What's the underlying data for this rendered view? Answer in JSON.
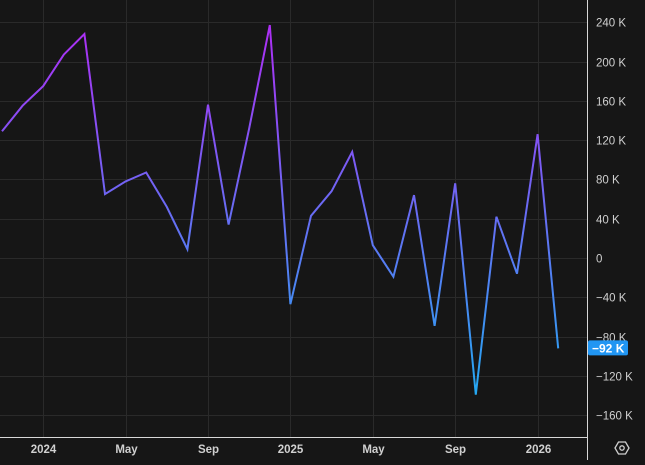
{
  "chart_data": {
    "type": "line",
    "title": "",
    "xlabel": "",
    "ylabel": "",
    "x": [
      "2023-11",
      "2023-12",
      "2024-01",
      "2024-02",
      "2024-03",
      "2024-04",
      "2024-05",
      "2024-06",
      "2024-07",
      "2024-08",
      "2024-09",
      "2024-10",
      "2024-11",
      "2024-12",
      "2025-01",
      "2025-02",
      "2025-03",
      "2025-04",
      "2025-05",
      "2025-06",
      "2025-07",
      "2025-08",
      "2025-09",
      "2025-10",
      "2025-11",
      "2025-12",
      "2026-01",
      "2026-02"
    ],
    "values": [
      129000,
      155000,
      175000,
      207000,
      228000,
      65000,
      78000,
      87000,
      52000,
      9000,
      156000,
      34000,
      132000,
      237000,
      -47000,
      43000,
      68000,
      108000,
      13000,
      -19000,
      64000,
      -69000,
      76000,
      -139000,
      42000,
      -16000,
      126000,
      -92000
    ],
    "ylim": [
      -180000,
      262000
    ],
    "y_ticks": [
      {
        "value": 240000,
        "label": "240 K"
      },
      {
        "value": 200000,
        "label": "200 K"
      },
      {
        "value": 160000,
        "label": "160 K"
      },
      {
        "value": 120000,
        "label": "120 K"
      },
      {
        "value": 80000,
        "label": "80 K"
      },
      {
        "value": 40000,
        "label": "40 K"
      },
      {
        "value": 0,
        "label": "0"
      },
      {
        "value": -40000,
        "label": "−40 K"
      },
      {
        "value": -80000,
        "label": "−80 K"
      },
      {
        "value": -120000,
        "label": "−120 K"
      },
      {
        "value": -160000,
        "label": "−160 K"
      }
    ],
    "x_ticks": [
      {
        "index": 2,
        "label": "2024"
      },
      {
        "index": 6,
        "label": "May"
      },
      {
        "index": 10,
        "label": "Sep"
      },
      {
        "index": 14,
        "label": "2025"
      },
      {
        "index": 18,
        "label": "May"
      },
      {
        "index": 22,
        "label": "Sep"
      },
      {
        "index": 26,
        "label": "2026"
      }
    ],
    "last_value_label": "−92 K",
    "grid": true,
    "colors": {
      "top": "#b02cf5",
      "bottom": "#22aaf2",
      "badge": "#2196f3",
      "grid": "#2a2a2a",
      "text": "#d0d0d0"
    }
  },
  "settings_icon": "settings-hex-icon"
}
